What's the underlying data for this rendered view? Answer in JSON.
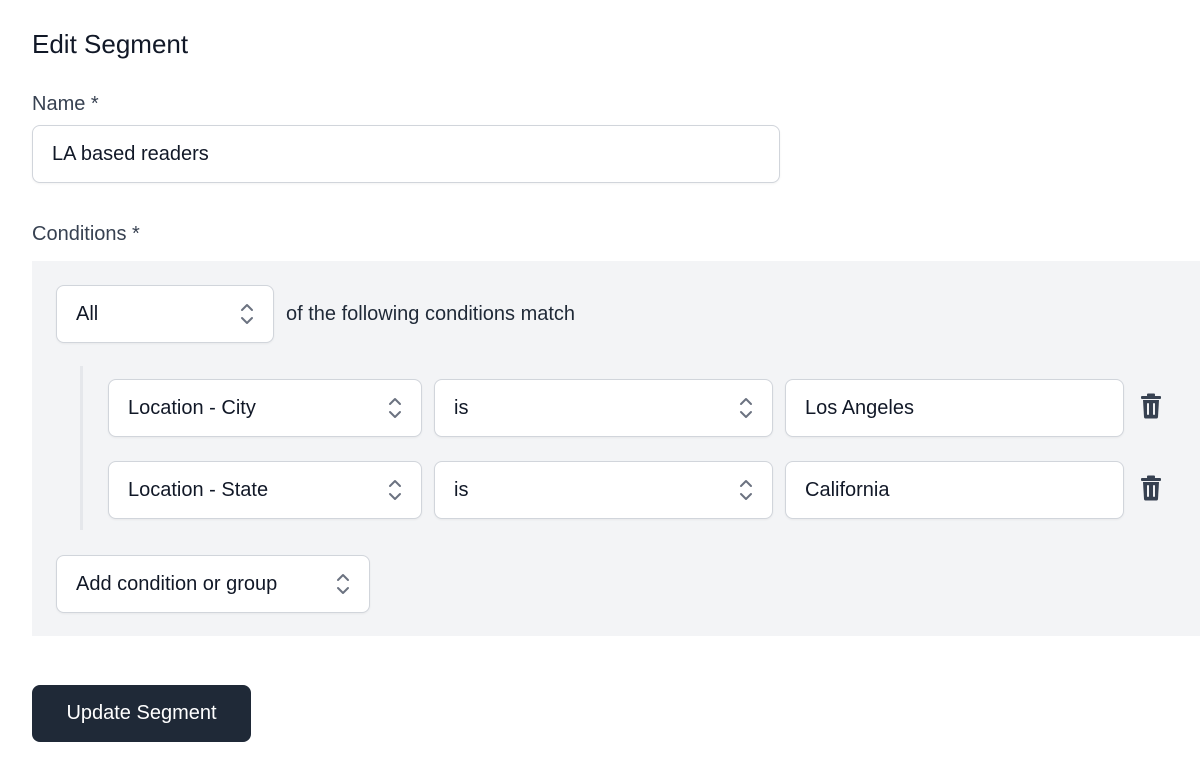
{
  "page": {
    "title": "Edit Segment"
  },
  "name_field": {
    "label": "Name *",
    "value": "LA based readers"
  },
  "conditions": {
    "label": "Conditions *",
    "match_select": "All",
    "match_text": "of the following conditions match",
    "rules": [
      {
        "field": "Location - City",
        "operator": "is",
        "value": "Los Angeles"
      },
      {
        "field": "Location - State",
        "operator": "is",
        "value": "California"
      }
    ],
    "add_label": "Add condition or group"
  },
  "actions": {
    "submit_label": "Update Segment"
  },
  "icons": {
    "select_chevrons": "chevron-up-down-icon",
    "delete": "trash-icon"
  },
  "colors": {
    "primary_button": "#1f2937",
    "panel_background": "#f3f4f6",
    "border": "#d1d5db"
  }
}
